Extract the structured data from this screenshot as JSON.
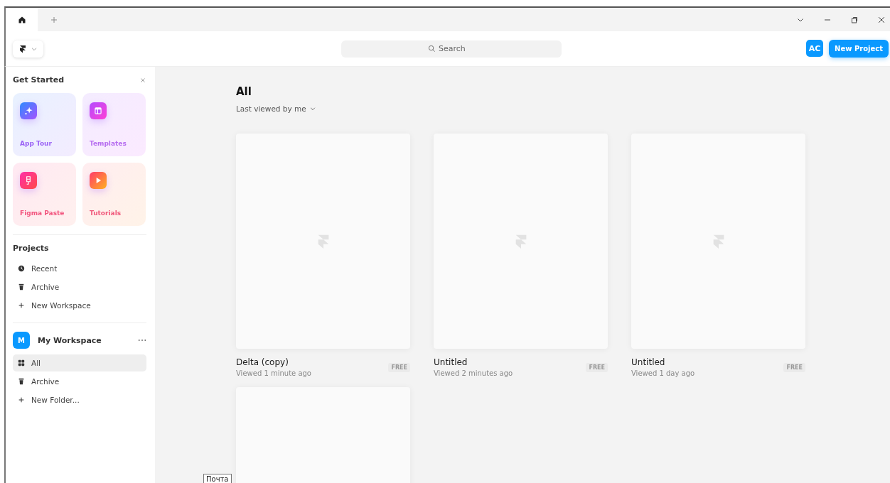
{
  "tabs": [
    {
      "kind": "home",
      "selected": true
    },
    {
      "kind": "add",
      "selected": false
    }
  ],
  "header": {
    "search": {
      "placeholder": "Search"
    },
    "avatar": "AC",
    "new_button": "New Project"
  },
  "get_started": {
    "title": "Get Started",
    "tiles": [
      {
        "kind": "tour",
        "label": "App Tour"
      },
      {
        "kind": "templates",
        "label": "Templates"
      },
      {
        "kind": "paste",
        "label": "Figma Paste"
      },
      {
        "kind": "tutorials",
        "label": "Tutorials"
      }
    ]
  },
  "projects": {
    "title": "Projects",
    "items": [
      {
        "kind": "recent",
        "label": "Recent"
      },
      {
        "kind": "archive",
        "label": "Archive"
      },
      {
        "kind": "new",
        "label": "New Workspace"
      }
    ]
  },
  "workspace": {
    "initial": "M",
    "name": "My Workspace",
    "items": [
      {
        "kind": "all",
        "label": "All",
        "selected": true
      },
      {
        "kind": "archive",
        "label": "Archive",
        "selected": false
      },
      {
        "kind": "new",
        "label": "New Folder...",
        "selected": false
      }
    ]
  },
  "main": {
    "title": "All",
    "sort": "Last viewed by me",
    "cards": [
      {
        "kind": "full",
        "title": "Delta (copy)",
        "viewed": "Viewed 1 minute ago",
        "badge": "FREE"
      },
      {
        "kind": "full",
        "title": "Untitled",
        "viewed": "Viewed 2 minutes ago",
        "badge": "FREE"
      },
      {
        "kind": "full",
        "title": "Untitled",
        "viewed": "Viewed 1 day ago",
        "badge": "FREE"
      },
      {
        "kind": "partial"
      }
    ]
  },
  "tooltip": "Почта"
}
